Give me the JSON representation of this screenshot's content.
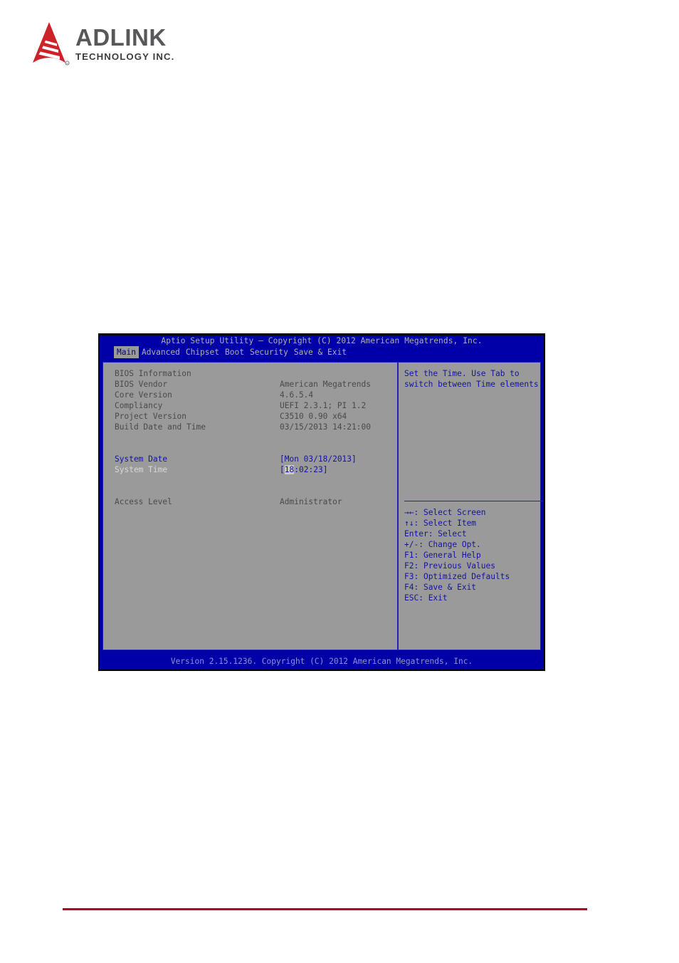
{
  "brand": {
    "name": "ADLINK",
    "tagline": "TECHNOLOGY INC.",
    "logo_icon": "adlink-triangle-icon",
    "accent_color": "#cc2229",
    "wordmark_color": "#58585a"
  },
  "bios": {
    "title": "Aptio Setup Utility – Copyright (C) 2012 American Megatrends, Inc.",
    "footer": "Version 2.15.1236. Copyright (C) 2012 American Megatrends, Inc.",
    "background_color": "#0000a8",
    "panel_color": "#9a9a9a",
    "accent_color": "#1414a0",
    "tabs": [
      {
        "label": "Main",
        "active": true
      },
      {
        "label": "Advanced",
        "active": false
      },
      {
        "label": "Chipset",
        "active": false
      },
      {
        "label": "Boot",
        "active": false
      },
      {
        "label": "Security",
        "active": false
      },
      {
        "label": "Save & Exit",
        "active": false
      }
    ],
    "section_heading": "BIOS Information",
    "info_rows": [
      {
        "label": "BIOS Vendor",
        "value": "American Megatrends"
      },
      {
        "label": "Core Version",
        "value": "4.6.5.4"
      },
      {
        "label": "Compliancy",
        "value": "UEFI 2.3.1; PI 1.2"
      },
      {
        "label": "Project Version",
        "value": "C3510 0.90 x64"
      },
      {
        "label": "Build Date and Time",
        "value": "03/15/2013 14:21:00"
      }
    ],
    "system_date": {
      "label": "System Date",
      "value": "[Mon 03/18/2013]"
    },
    "system_time": {
      "label": "System Time",
      "open_bracket": "[",
      "hours": "18",
      "sep1": ":",
      "minutes": "02",
      "sep2": ":",
      "seconds": "23",
      "close_bracket": "]"
    },
    "access_level": {
      "label": "Access Level",
      "value": "Administrator"
    },
    "help": {
      "line1": "Set the Time. Use Tab to",
      "line2": "switch between Time elements."
    },
    "keys": [
      {
        "key": "→←",
        "action": ": Select Screen"
      },
      {
        "key": "↑↓",
        "action": ": Select Item"
      },
      {
        "key": "Enter",
        "action": ": Select"
      },
      {
        "key": "+/-",
        "action": ": Change Opt."
      },
      {
        "key": "F1",
        "action": ": General Help"
      },
      {
        "key": "F2",
        "action": ": Previous Values"
      },
      {
        "key": "F3",
        "action": ": Optimized Defaults"
      },
      {
        "key": "F4",
        "action": ": Save & Exit"
      },
      {
        "key": "ESC",
        "action": ": Exit"
      }
    ]
  }
}
